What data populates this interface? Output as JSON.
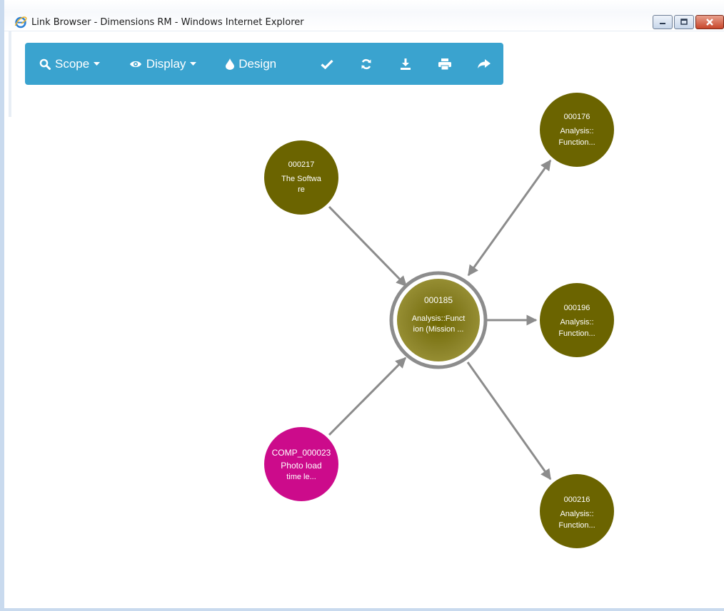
{
  "window": {
    "title": "Link Browser - Dimensions RM - Windows Internet Explorer"
  },
  "toolbar": {
    "scope_label": "Scope",
    "display_label": "Display",
    "design_label": "Design",
    "icons": [
      "search-icon",
      "eye-icon",
      "tint-icon",
      "check-icon",
      "refresh-icon",
      "download-icon",
      "print-icon",
      "share-icon"
    ]
  },
  "colors": {
    "toolbar_bg": "#3aa3cf",
    "node_olive": "#6b6400",
    "node_magenta": "#cc0b8b",
    "center_node": "#8a8228",
    "edge": "#8c8c8c"
  },
  "graph": {
    "center": {
      "id": "000185",
      "line1": "Analysis::Funct",
      "line2": "ion (Mission ..."
    },
    "nodes": [
      {
        "key": "n217",
        "id": "000217",
        "line1": "The Softwa",
        "line2": "re",
        "color": "olive"
      },
      {
        "key": "n176",
        "id": "000176",
        "line1": "Analysis::",
        "line2": "Function...",
        "color": "olive"
      },
      {
        "key": "n196",
        "id": "000196",
        "line1": "Analysis::",
        "line2": "Function...",
        "color": "olive"
      },
      {
        "key": "n023",
        "id": "COMP_000023",
        "line1": "Photo load",
        "line2": "time le...",
        "color": "magenta"
      },
      {
        "key": "n216",
        "id": "000216",
        "line1": "Analysis::",
        "line2": "Function...",
        "color": "olive"
      }
    ]
  }
}
